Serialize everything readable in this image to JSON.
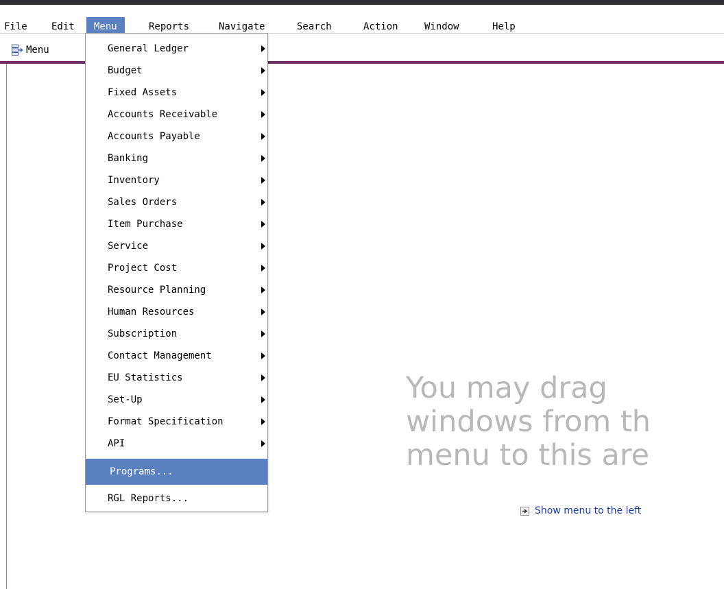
{
  "menubar": {
    "items": [
      {
        "label": "File",
        "active": false
      },
      {
        "label": "Edit",
        "active": false
      },
      {
        "label": "Menu",
        "active": true
      },
      {
        "label": "Reports",
        "active": false
      },
      {
        "label": "Navigate",
        "active": false
      },
      {
        "label": "Search",
        "active": false
      },
      {
        "label": "Action",
        "active": false
      },
      {
        "label": "Window",
        "active": false
      },
      {
        "label": "Help",
        "active": false
      }
    ]
  },
  "toolbar": {
    "menu_label": "Menu",
    "menu_icon": "menu-tree-icon"
  },
  "dropdown": {
    "items": [
      {
        "label": "General Ledger",
        "submenu": true
      },
      {
        "label": "Budget",
        "submenu": true
      },
      {
        "label": "Fixed Assets",
        "submenu": true
      },
      {
        "label": "Accounts Receivable",
        "submenu": true
      },
      {
        "label": "Accounts Payable",
        "submenu": true
      },
      {
        "label": "Banking",
        "submenu": true
      },
      {
        "label": "Inventory",
        "submenu": true
      },
      {
        "label": "Sales Orders",
        "submenu": true
      },
      {
        "label": "Item Purchase",
        "submenu": true
      },
      {
        "label": "Service",
        "submenu": true
      },
      {
        "label": "Project Cost",
        "submenu": true
      },
      {
        "label": "Resource Planning",
        "submenu": true
      },
      {
        "label": "Human Resources",
        "submenu": true
      },
      {
        "label": "Subscription",
        "submenu": true
      },
      {
        "label": "Contact Management",
        "submenu": true
      },
      {
        "label": "EU Statistics",
        "submenu": true
      },
      {
        "label": "Set-Up",
        "submenu": true
      },
      {
        "label": "Format Specification",
        "submenu": true
      },
      {
        "label": "API",
        "submenu": true
      },
      {
        "label": "Programs...",
        "submenu": false,
        "highlighted": true
      },
      {
        "label": "RGL Reports...",
        "submenu": false
      }
    ]
  },
  "workspace": {
    "hint_lines": [
      "You may drag",
      "windows from th",
      "menu to this are"
    ],
    "show_menu_label": "Show menu to the left",
    "show_menu_icon": "arrow-right-icon"
  },
  "colors": {
    "highlight": "#5b80c0",
    "toolbar_accent": "#6e2f66",
    "hint_text": "#b8b8b8",
    "link": "#1a3f9c"
  }
}
